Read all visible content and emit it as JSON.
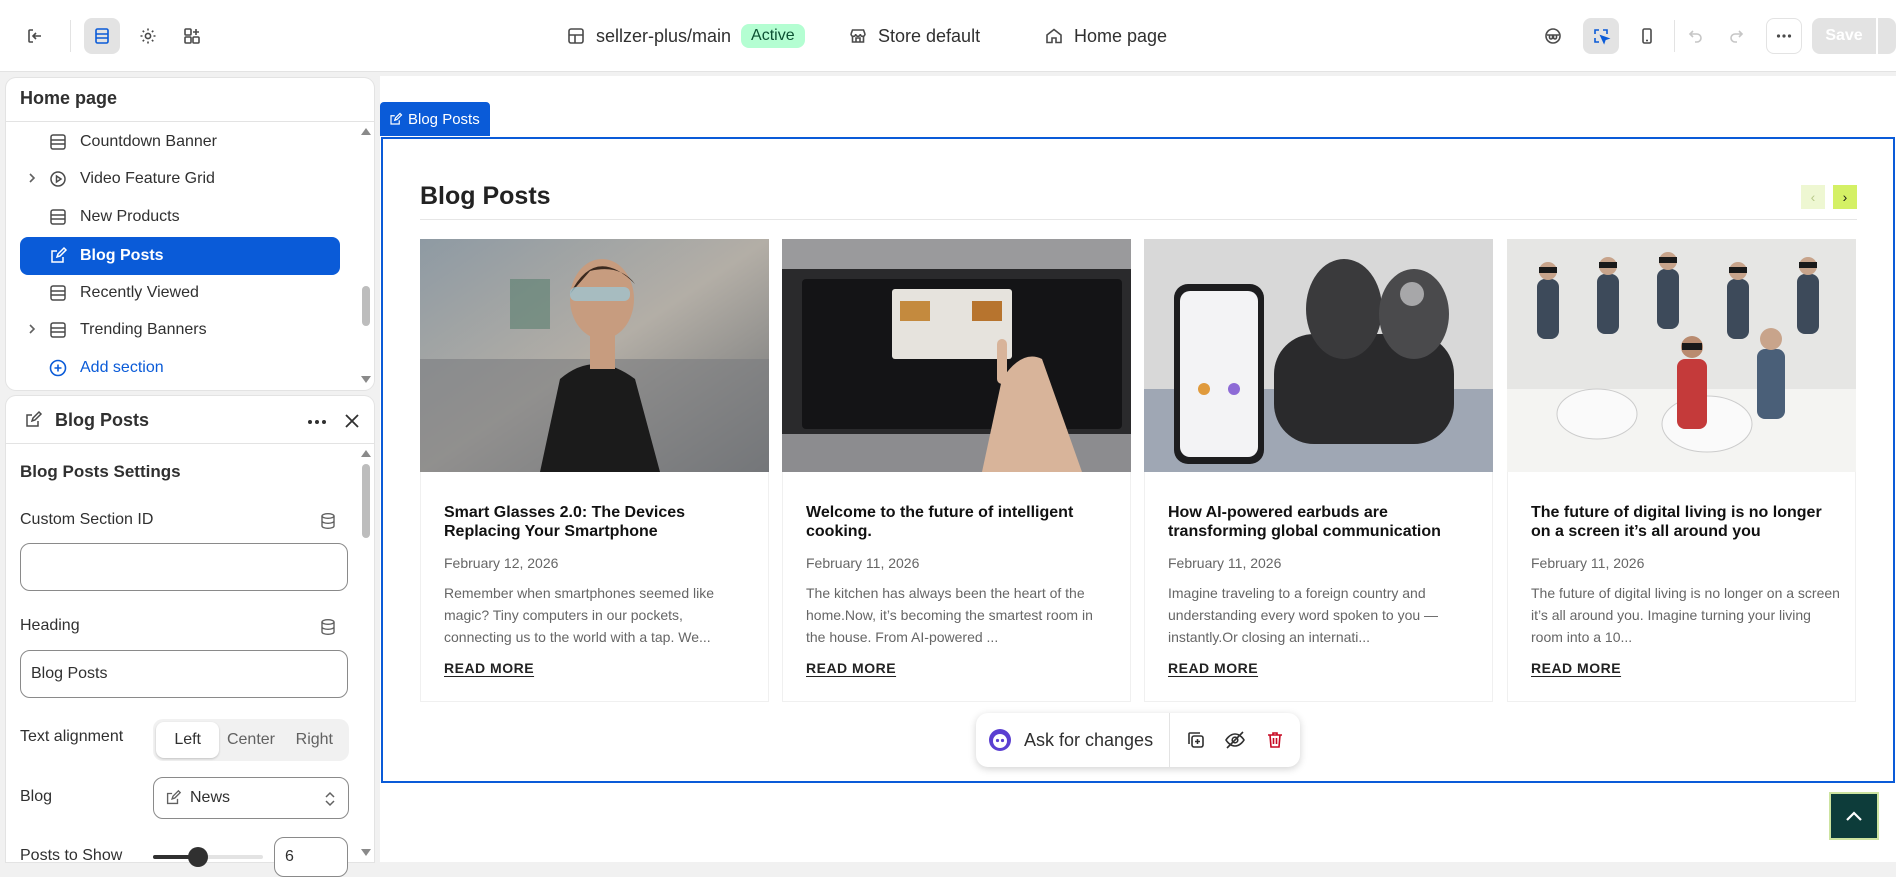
{
  "topbar": {
    "theme_name": "sellzer-plus/main",
    "theme_status": "Active",
    "store": "Store default",
    "page": "Home page",
    "save_label": "Save"
  },
  "sections_panel": {
    "title": "Home page",
    "items": [
      {
        "label": "Countdown Banner",
        "icon": "section-icon",
        "expandable": false
      },
      {
        "label": "Video Feature Grid",
        "icon": "play-circle-icon",
        "expandable": true
      },
      {
        "label": "New Products",
        "icon": "section-icon",
        "expandable": false
      },
      {
        "label": "Blog Posts",
        "icon": "edit-icon",
        "expandable": false,
        "active": true
      },
      {
        "label": "Recently Viewed",
        "icon": "section-icon",
        "expandable": false
      },
      {
        "label": "Trending Banners",
        "icon": "section-icon",
        "expandable": true
      }
    ],
    "add_label": "Add section"
  },
  "settings_panel": {
    "title": "Blog Posts",
    "subtitle": "Blog Posts Settings",
    "custom_id_label": "Custom Section ID",
    "custom_id_value": "",
    "heading_label": "Heading",
    "heading_value": "Blog Posts",
    "alignment_label": "Text alignment",
    "alignment_options": [
      "Left",
      "Center",
      "Right"
    ],
    "alignment_selected": "Left",
    "blog_label": "Blog",
    "blog_value": "News",
    "posts_label": "Posts to Show",
    "posts_value": "6"
  },
  "preview": {
    "section_tag": "Blog Posts",
    "heading": "Blog Posts",
    "posts": [
      {
        "title": "Smart Glasses 2.0: The Devices Replacing Your Smartphone",
        "date": "February 12, 2026",
        "excerpt": "Remember when smartphones seemed like magic? Tiny computers in our pockets, connecting us to the world with a tap. We...",
        "more": "READ MORE"
      },
      {
        "title": "Welcome to the future of intelligent cooking.",
        "date": "February 11, 2026",
        "excerpt": "The kitchen has always been the heart of the home.Now, it’s becoming the smartest room in the house. From AI-powered ...",
        "more": "READ MORE"
      },
      {
        "title": "How AI-powered earbuds are transforming global communication",
        "date": "February 11, 2026",
        "excerpt": "Imagine traveling to a foreign country and understanding every word spoken to you — instantly.Or closing an internati...",
        "more": "READ MORE"
      },
      {
        "title": "The future of digital living is no longer on a screen it’s all around you",
        "date": "February 11, 2026",
        "excerpt": "The future of digital living is no longer on a screen it’s all around you. Imagine turning your living room into a 10...",
        "more": "READ MORE"
      }
    ],
    "ask_label": "Ask for changes"
  },
  "colors": {
    "accent": "#0a5bd8",
    "arrow_bg": "#d4f065",
    "back_top_bg": "#0d3c3a"
  }
}
